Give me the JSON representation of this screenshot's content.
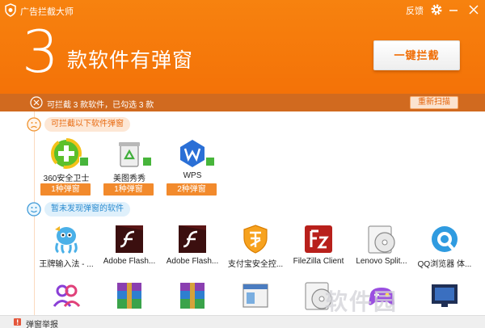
{
  "titlebar": {
    "app_title": "广告拦截大师",
    "feedback": "反馈"
  },
  "header": {
    "count": "3",
    "headline": "款软件有弹窗",
    "block_button": "一键拦截"
  },
  "status": {
    "text": "可拦截 3 款软件，已勾选 3 款",
    "rescan_button": "重新扫描"
  },
  "blockable": {
    "title": "可拦截以下软件弹窗",
    "apps": [
      {
        "name": "360安全卫士",
        "badge": "1种弹窗",
        "icon": "360-security-icon"
      },
      {
        "name": "美图秀秀",
        "badge": "1种弹窗",
        "icon": "recycle-icon"
      },
      {
        "name": "WPS",
        "badge": "2种弹窗",
        "icon": "wps-icon"
      }
    ]
  },
  "nopopup": {
    "title": "暂未发现弹窗的软件",
    "apps": [
      {
        "name": "王牌输入法 - ...",
        "icon": "octopus-icon"
      },
      {
        "name": "Adobe Flash...",
        "icon": "adobe-flash-icon"
      },
      {
        "name": "Adobe Flash...",
        "icon": "adobe-flash-icon"
      },
      {
        "name": "支付宝安全控...",
        "icon": "alipay-shield-icon"
      },
      {
        "name": "FileZilla Client",
        "icon": "filezilla-icon"
      },
      {
        "name": "Lenovo Split...",
        "icon": "disc-icon"
      },
      {
        "name": "QQ浏览器 体...",
        "icon": "qq-browser-icon"
      }
    ]
  },
  "bottom": {
    "report": "弹窗举报",
    "watermark": "软件园"
  },
  "colors": {
    "orange": "#f47a0b",
    "status_bar": "#d16a1f",
    "badge": "#f28a2c"
  }
}
